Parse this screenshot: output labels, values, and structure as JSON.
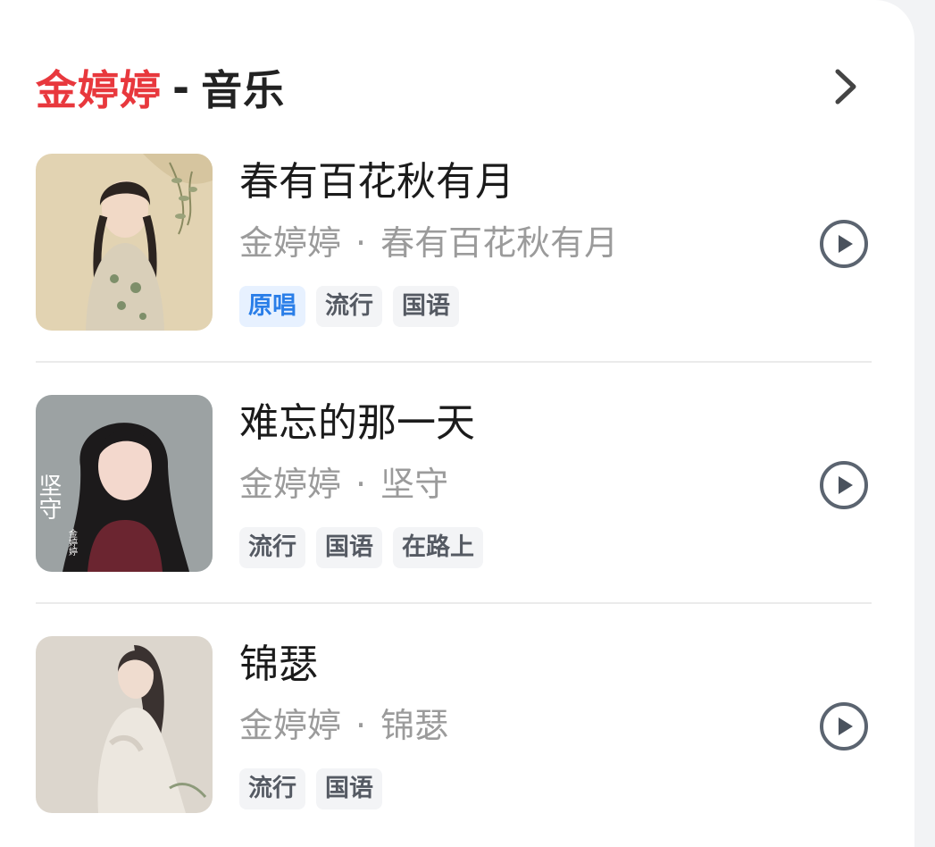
{
  "header": {
    "artist": "金婷婷",
    "separator": "-",
    "section": "音乐",
    "more_icon": "chevron-right-icon"
  },
  "songs": [
    {
      "title": "春有百花秋有月",
      "artist": "金婷婷",
      "separator": "·",
      "album": "春有百花秋有月",
      "tags": [
        "原唱",
        "流行",
        "国语"
      ],
      "play_icon": "play-circle-icon"
    },
    {
      "title": "难忘的那一天",
      "artist": "金婷婷",
      "separator": "·",
      "album": "坚守",
      "tags": [
        "流行",
        "国语",
        "在路上"
      ],
      "play_icon": "play-circle-icon"
    },
    {
      "title": "锦瑟",
      "artist": "金婷婷",
      "separator": "·",
      "album": "锦瑟",
      "tags": [
        "流行",
        "国语"
      ],
      "play_icon": "play-circle-icon"
    }
  ],
  "cover_text": {
    "album_title": "坚守",
    "artist_signature": "金婷婷"
  },
  "colors": {
    "artist_accent": "#e8383d",
    "original_tag_text": "#2a7ee8",
    "original_tag_bg": "#e7f1ff"
  }
}
